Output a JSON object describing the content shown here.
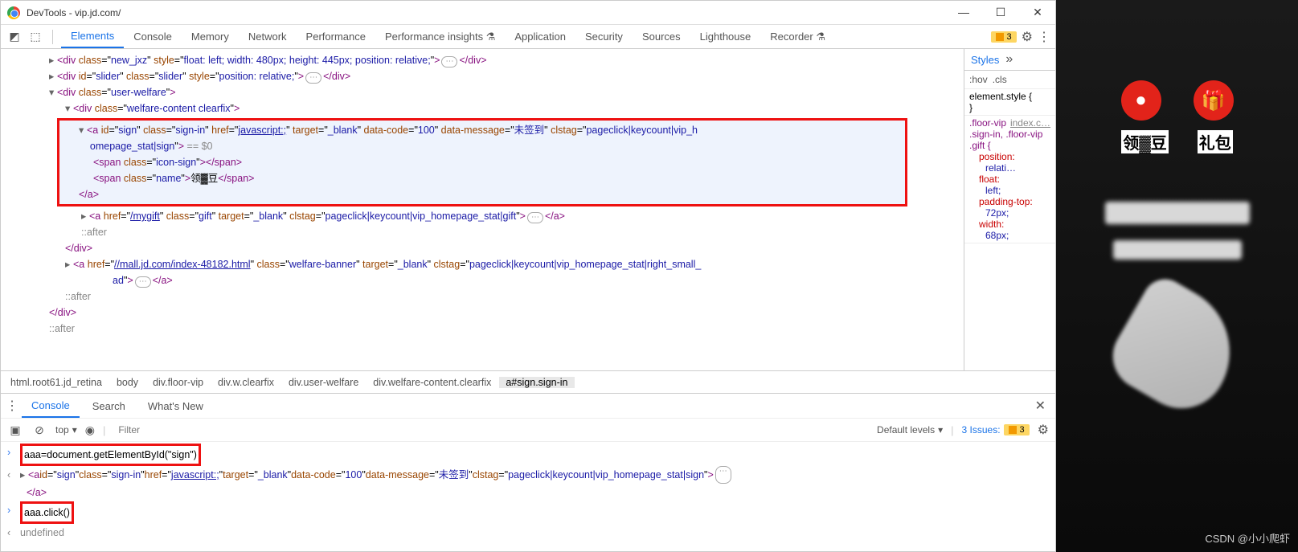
{
  "window": {
    "title": "DevTools - vip.jd.com/"
  },
  "tabs": [
    "Elements",
    "Console",
    "Memory",
    "Network",
    "Performance",
    "Performance insights ⚗",
    "Application",
    "Security",
    "Sources",
    "Lighthouse",
    "Recorder ⚗"
  ],
  "issues_count": "3",
  "dom": {
    "new_jxz": "<div class=\"new_jxz\" style=\"float: left; width: 480px; height: 445px; position: relative;\">",
    "slider": "<div id=\"slider\" class=\"slider\" style=\"position: relative;\">",
    "user_welfare": "<div class=\"user-welfare\">",
    "welfare_content": "<div class=\"welfare-content clearfix\">",
    "sign_open": "<a id=\"sign\" class=\"sign-in\" href=\"javascript:;\" target=\"_blank\" data-code=\"100\" data-message=\"未签到\" clstag=\"pageclick|keycount|vip_homepage_stat|sign\">",
    "sign_link": "javascript:;",
    "eq0": " == $0",
    "icon_sign": "<span class=\"icon-sign\"></span>",
    "name_span_open": "<span class=\"name\">",
    "name_text": "领▓豆",
    "name_span_close": "</span>",
    "a_close": "</a>",
    "gift": "<a href=\"/mygift\" class=\"gift\" target=\"_blank\" clstag=\"pageclick|keycount|vip_homepage_stat|gift\">",
    "gift_link": "/mygift",
    "after": "::after",
    "div_close": "</div>",
    "banner": "<a href=\"//mall.jd.com/index-48182.html\" class=\"welfare-banner\" target=\"_blank\" clstag=\"pageclick|keycount|vip_homepage_stat|right_small_ad\">",
    "banner_link": "//mall.jd.com/index-48182.html"
  },
  "breadcrumb": [
    "html.root61.jd_retina",
    "body",
    "div.floor-vip",
    "div.w.clearfix",
    "div.user-welfare",
    "div.welfare-content.clearfix",
    "a#sign.sign-in"
  ],
  "styles": {
    "tab": "Styles",
    "hov": ":hov",
    "cls": ".cls",
    "inline": "element.style {",
    "source": "index.c…",
    "selector": ".floor-vip .sign-in, .floor-vip .gift {",
    "props": [
      [
        "position:",
        "relati…"
      ],
      [
        "float:",
        "left;"
      ],
      [
        "padding-top:",
        "72px;"
      ],
      [
        "width:",
        "68px;"
      ]
    ]
  },
  "drawer": {
    "tabs": [
      "Console",
      "Search",
      "What's New"
    ],
    "context": "top",
    "filter_placeholder": "Filter",
    "levels": "Default levels",
    "issues_text": "3 Issues:",
    "issues_badge": "3"
  },
  "console": {
    "line1": "aaa=document.getElementById(\"sign\")",
    "response_open": "<a id=\"sign\" class=\"sign-in\" href=\"",
    "response_link": "javascript:;",
    "response_rest": "\" target=\"_blank\" data-code=\"100\" data-message=\"未签到\" clstag=\"pageclick|keycount|vip_homepage_stat|sign\">",
    "response_close": "</a>",
    "line2": "aaa.click()",
    "return": "undefined"
  },
  "webpage": {
    "label1": "领▓豆",
    "label2": "礼包"
  },
  "watermark": "CSDN @小小爬虾"
}
